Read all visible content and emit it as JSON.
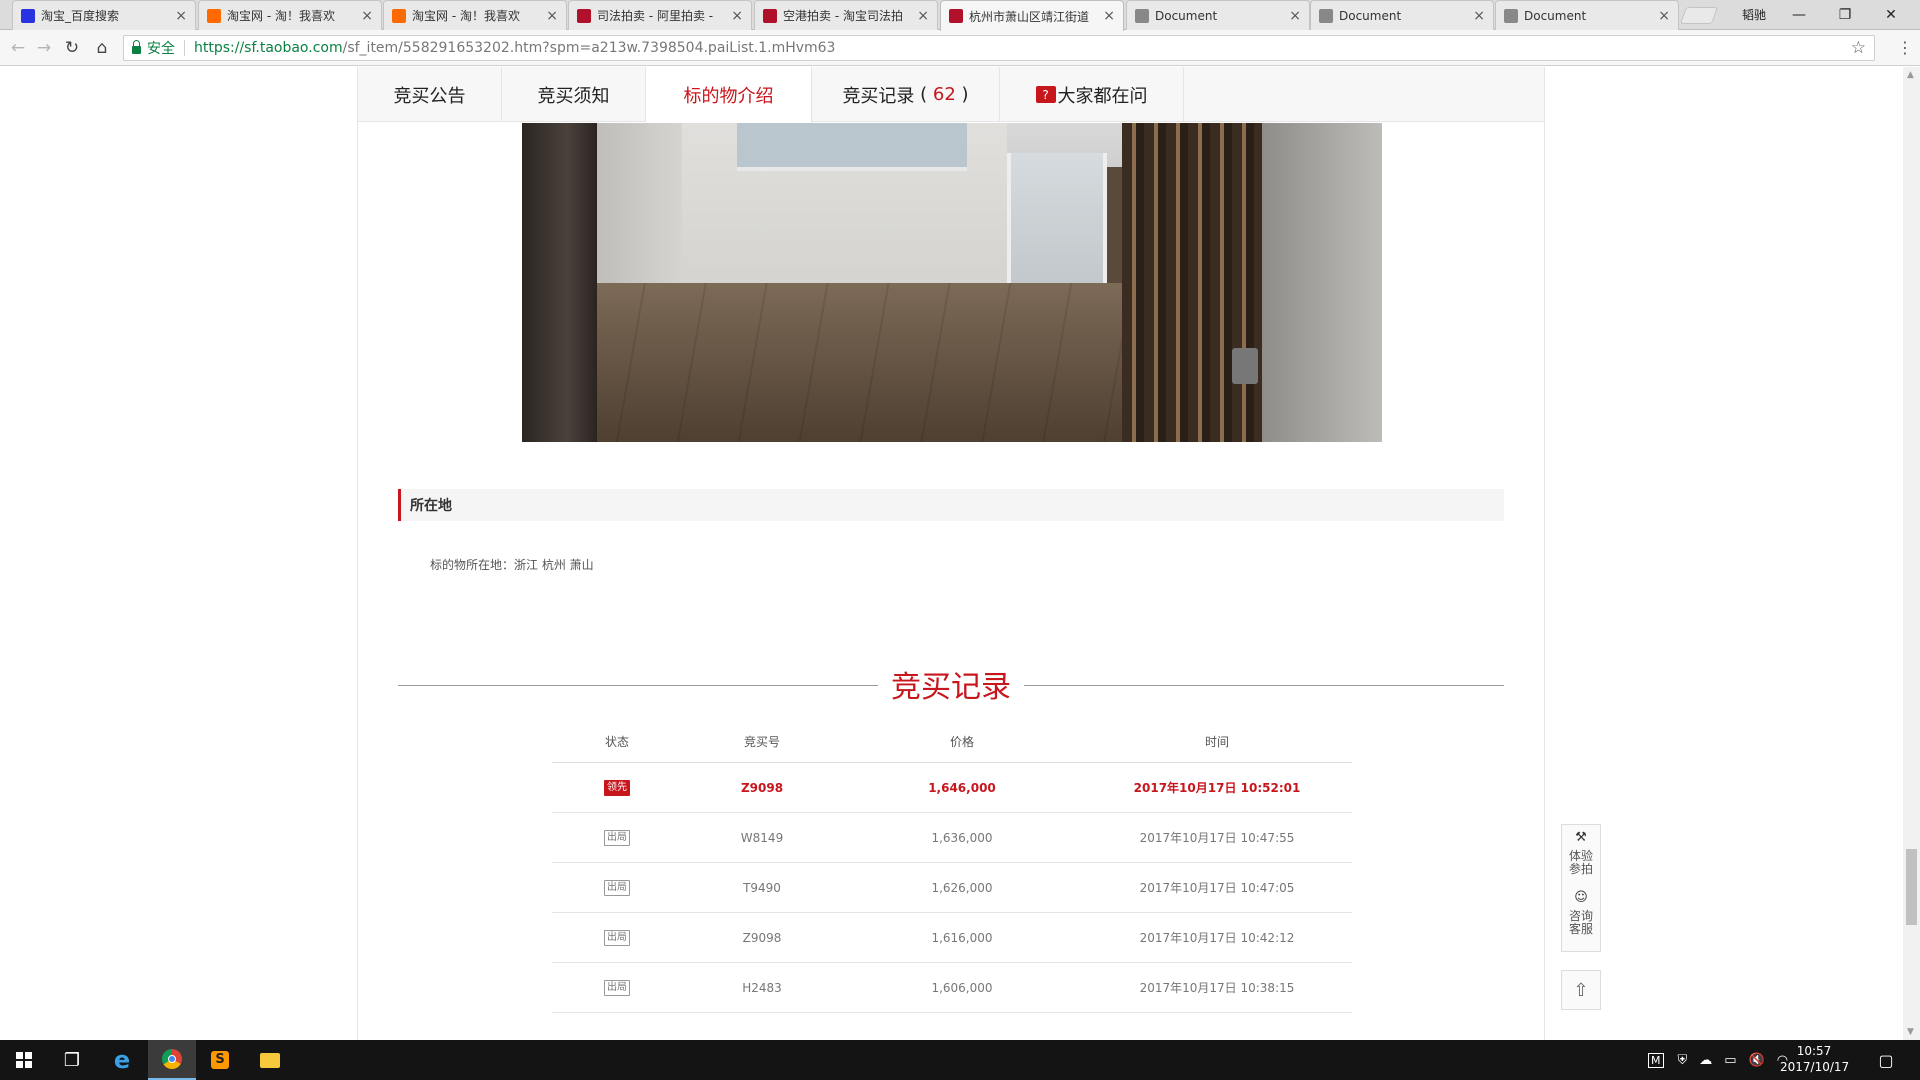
{
  "browser": {
    "tabs": [
      {
        "label": "淘宝_百度搜索",
        "favicon": "baidu-paw-icon",
        "color": "#2932e1"
      },
      {
        "label": "淘宝网 - 淘！我喜欢",
        "favicon": "taobao-icon",
        "color": "#ff6a00"
      },
      {
        "label": "淘宝网 - 淘！我喜欢",
        "favicon": "taobao-icon",
        "color": "#ff6a00"
      },
      {
        "label": "司法拍卖 - 阿里拍卖 -",
        "favicon": "ali-auction-icon",
        "color": "#b0102a"
      },
      {
        "label": "空港拍卖 - 淘宝司法拍",
        "favicon": "ali-auction-icon",
        "color": "#b0102a"
      },
      {
        "label": "杭州市萧山区靖江街道",
        "favicon": "ali-auction-icon",
        "color": "#b0102a"
      },
      {
        "label": "Document",
        "favicon": "document-icon",
        "color": "#888888"
      },
      {
        "label": "Document",
        "favicon": "document-icon",
        "color": "#888888"
      },
      {
        "label": "Document",
        "favicon": "document-icon",
        "color": "#888888"
      }
    ],
    "active_tab": 5,
    "user_chip": "韬驰",
    "secure_label": "安全",
    "url_host": "https://sf.taobao.com",
    "url_path": "/sf_item/558291653202.htm?spm=a213w.7398504.paiList.1.mHvm63"
  },
  "page": {
    "tab_nav": [
      "竞买公告",
      "竞买须知",
      "标的物介绍",
      "竞买记录",
      "大家都在问"
    ],
    "tab_nav_active": 2,
    "bid_count": "62",
    "section_location_title": "所在地",
    "location_text": "标的物所在地：浙江 杭州 萧山",
    "records_title": "竞买记录",
    "table_headers": [
      "状态",
      "竞买号",
      "价格",
      "时间"
    ],
    "records": [
      {
        "status": "领先",
        "bidder": "Z9098",
        "price": "1,646,000",
        "time": "2017年10月17日 10:52:01",
        "lead": true
      },
      {
        "status": "出局",
        "bidder": "W8149",
        "price": "1,636,000",
        "time": "2017年10月17日 10:47:55",
        "lead": false
      },
      {
        "status": "出局",
        "bidder": "T9490",
        "price": "1,626,000",
        "time": "2017年10月17日 10:47:05",
        "lead": false
      },
      {
        "status": "出局",
        "bidder": "Z9098",
        "price": "1,616,000",
        "time": "2017年10月17日 10:42:12",
        "lead": false
      },
      {
        "status": "出局",
        "bidder": "H2483",
        "price": "1,606,000",
        "time": "2017年10月17日 10:38:15",
        "lead": false
      }
    ],
    "float_panel": {
      "item1": "体验\n参拍",
      "item2": "咨询\n客服"
    },
    "accent_color": "#c8161d"
  },
  "taskbar": {
    "time": "10:57",
    "date": "2017/10/17",
    "tray_letter": "M"
  }
}
